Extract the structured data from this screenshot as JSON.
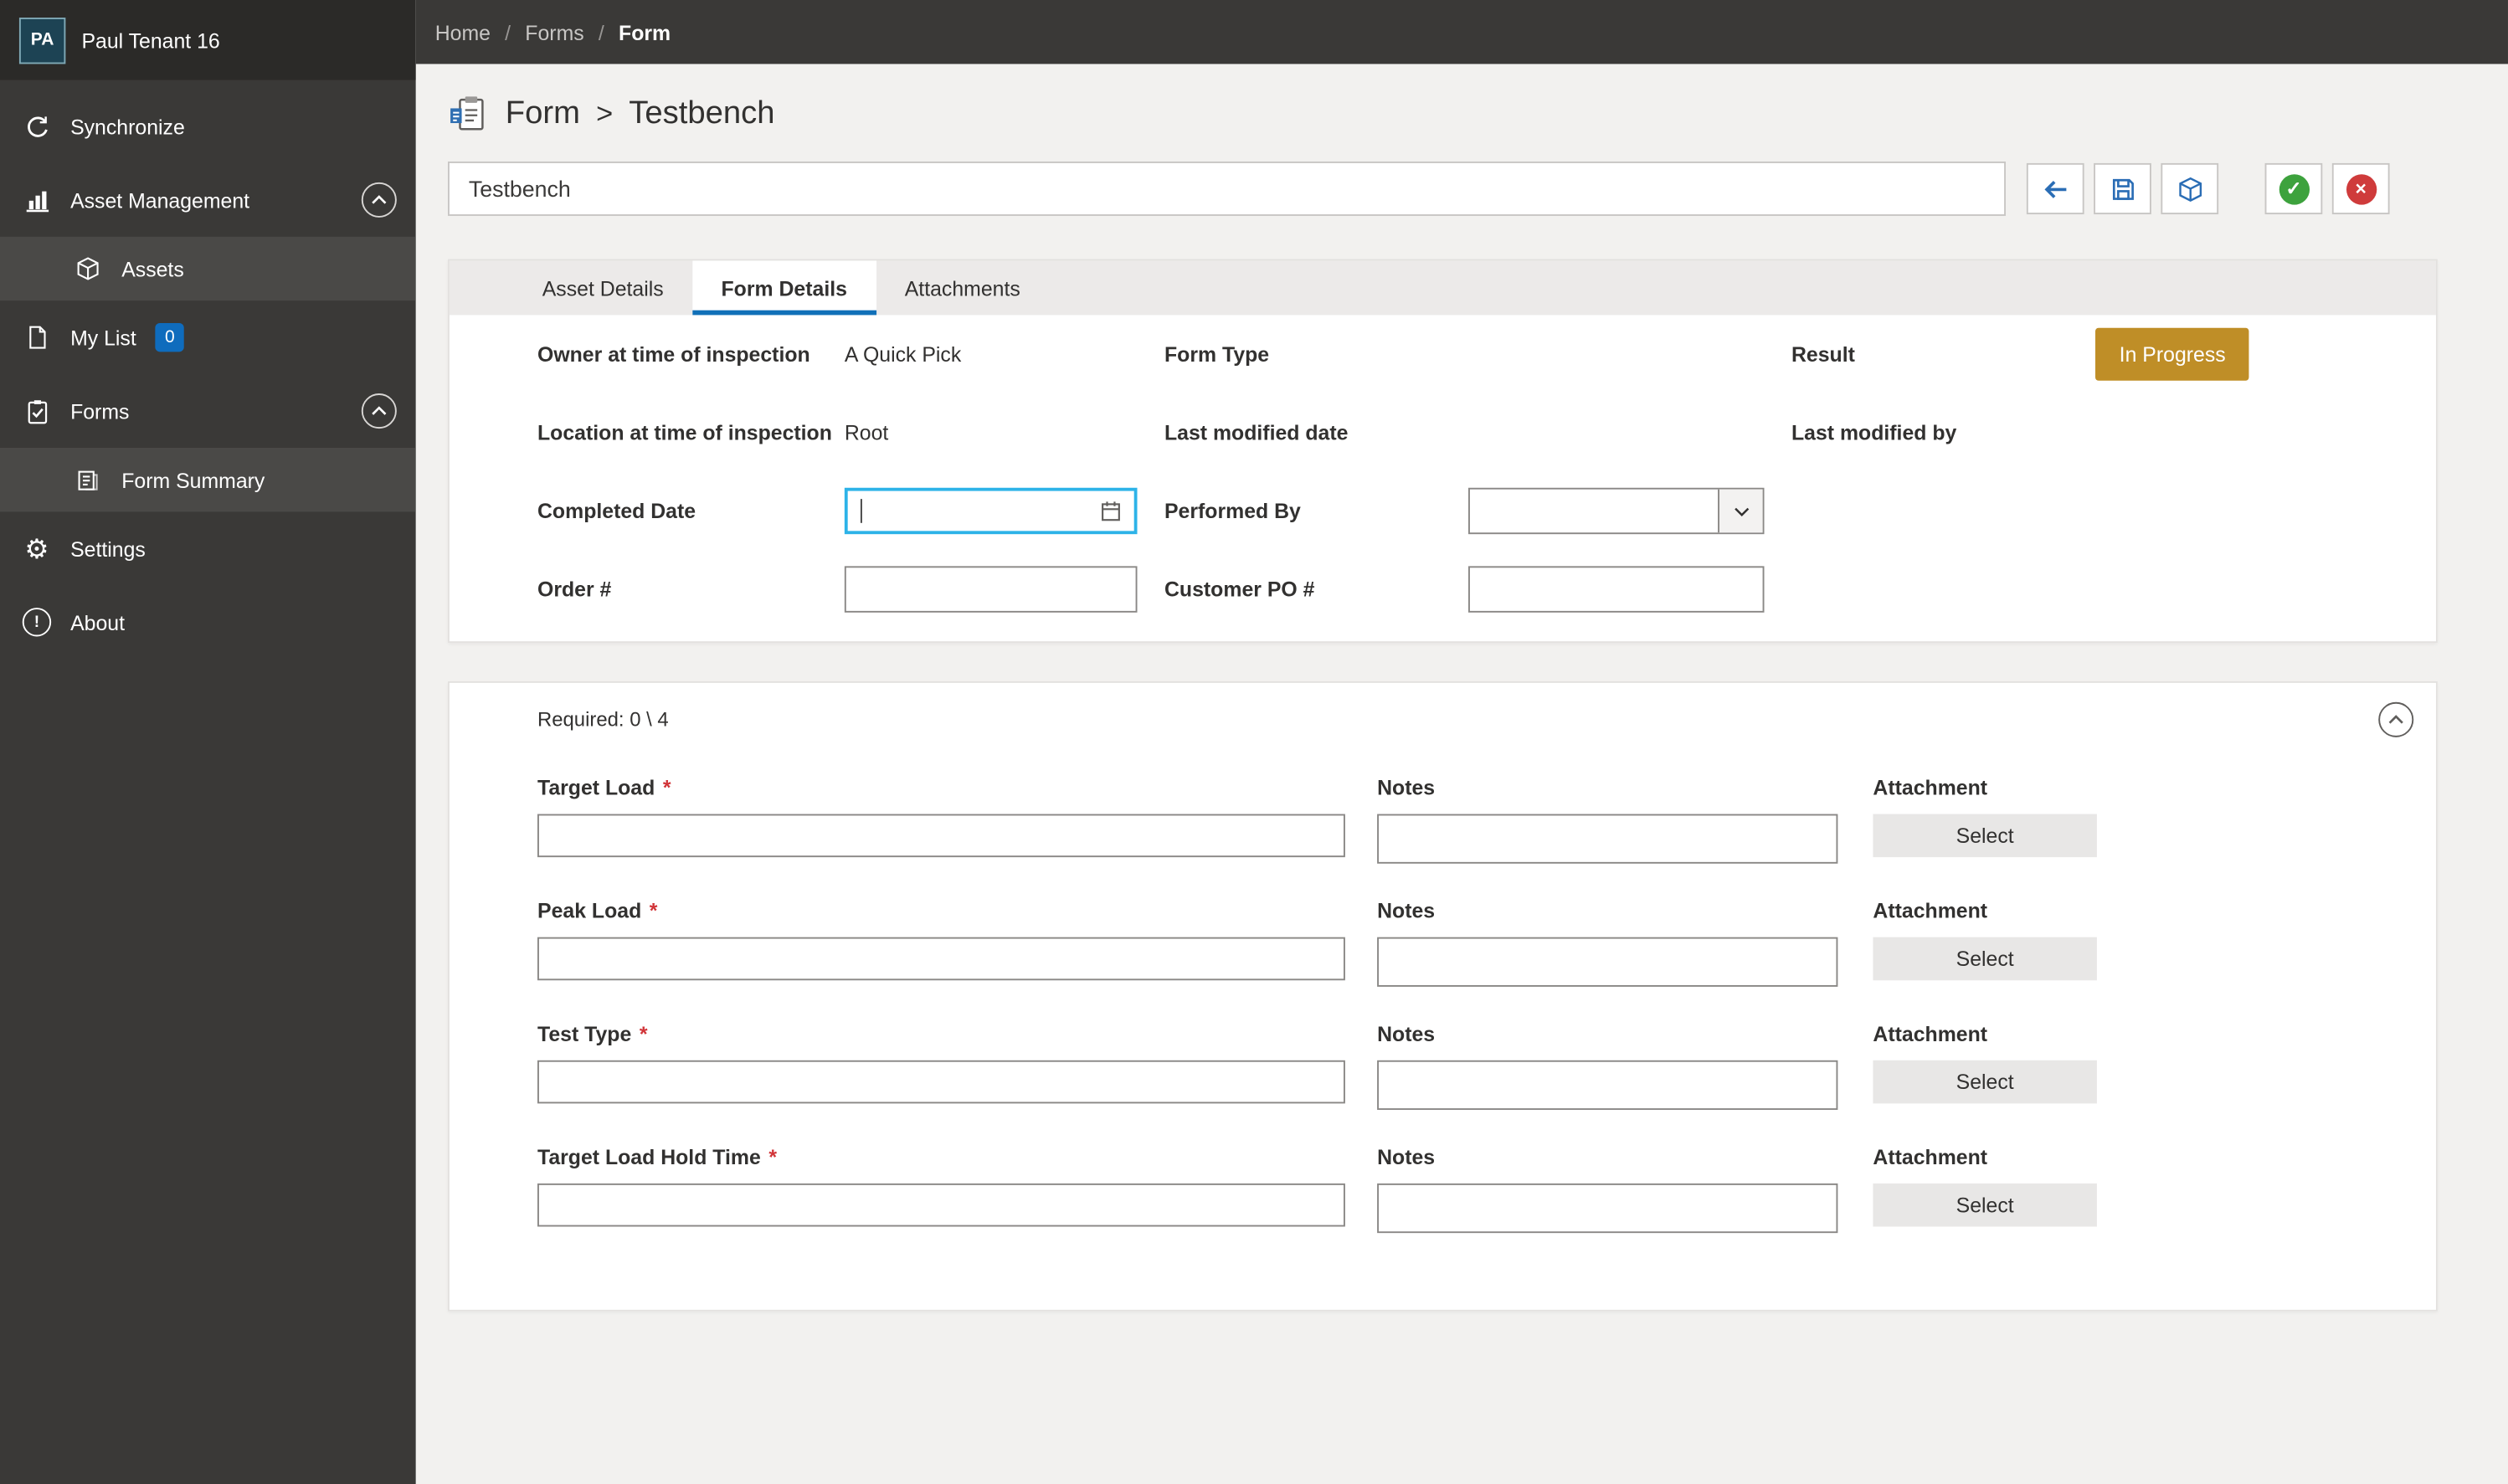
{
  "sidebar": {
    "tenant": {
      "initials": "PA",
      "name": "Paul Tenant 16"
    },
    "items": [
      {
        "label": "Synchronize"
      },
      {
        "label": "Asset Management"
      },
      {
        "label": "Assets"
      },
      {
        "label": "My List",
        "badge": "0"
      },
      {
        "label": "Forms"
      },
      {
        "label": "Form Summary"
      },
      {
        "label": "Settings"
      },
      {
        "label": "About"
      }
    ]
  },
  "breadcrumb": {
    "separator": "/",
    "items": [
      "Home",
      "Forms",
      "Form"
    ]
  },
  "page_header": {
    "title": "Form",
    "separator": ">",
    "subtitle": "Testbench"
  },
  "toolbar": {
    "form_name": "Testbench"
  },
  "tabs": [
    {
      "label": "Asset Details"
    },
    {
      "label": "Form Details"
    },
    {
      "label": "Attachments"
    }
  ],
  "details": {
    "owner_label": "Owner at time of inspection",
    "owner_value": "A Quick Pick",
    "form_type_label": "Form Type",
    "result_label": "Result",
    "result_value": "In Progress",
    "location_label": "Location at time of inspection",
    "location_value": "Root",
    "last_modified_date_label": "Last modified date",
    "last_modified_by_label": "Last modified by",
    "completed_date_label": "Completed Date",
    "completed_date_value": "",
    "performed_by_label": "Performed By",
    "performed_by_value": "",
    "order_label": "Order #",
    "order_value": "",
    "customer_po_label": "Customer PO #",
    "customer_po_value": ""
  },
  "required_section": {
    "required_text": "Required: 0 \\ 4",
    "required_marker": "*",
    "notes_label": "Notes",
    "attachment_label": "Attachment",
    "select_label": "Select",
    "fields": [
      {
        "label": "Target Load",
        "value": "",
        "notes_value": ""
      },
      {
        "label": "Peak Load",
        "value": "",
        "notes_value": ""
      },
      {
        "label": "Test Type",
        "value": "",
        "notes_value": ""
      },
      {
        "label": "Target Load Hold Time",
        "value": "",
        "notes_value": ""
      }
    ]
  },
  "icons": {
    "gear_glyph": "⚙",
    "about_glyph": "!",
    "check_glyph": "✓",
    "cross_glyph": "×"
  },
  "colors": {
    "sidebar_bg": "#3a3937",
    "accent_blue": "#1170b8",
    "icon_blue": "#2a6db5",
    "result_gold": "#bf8e27",
    "success_green": "#3da23d",
    "error_red": "#cf3b3b",
    "annotation_red": "#ee0d0d",
    "focus_cyan": "#2db3e8",
    "badge_blue": "#0f6cbd"
  }
}
